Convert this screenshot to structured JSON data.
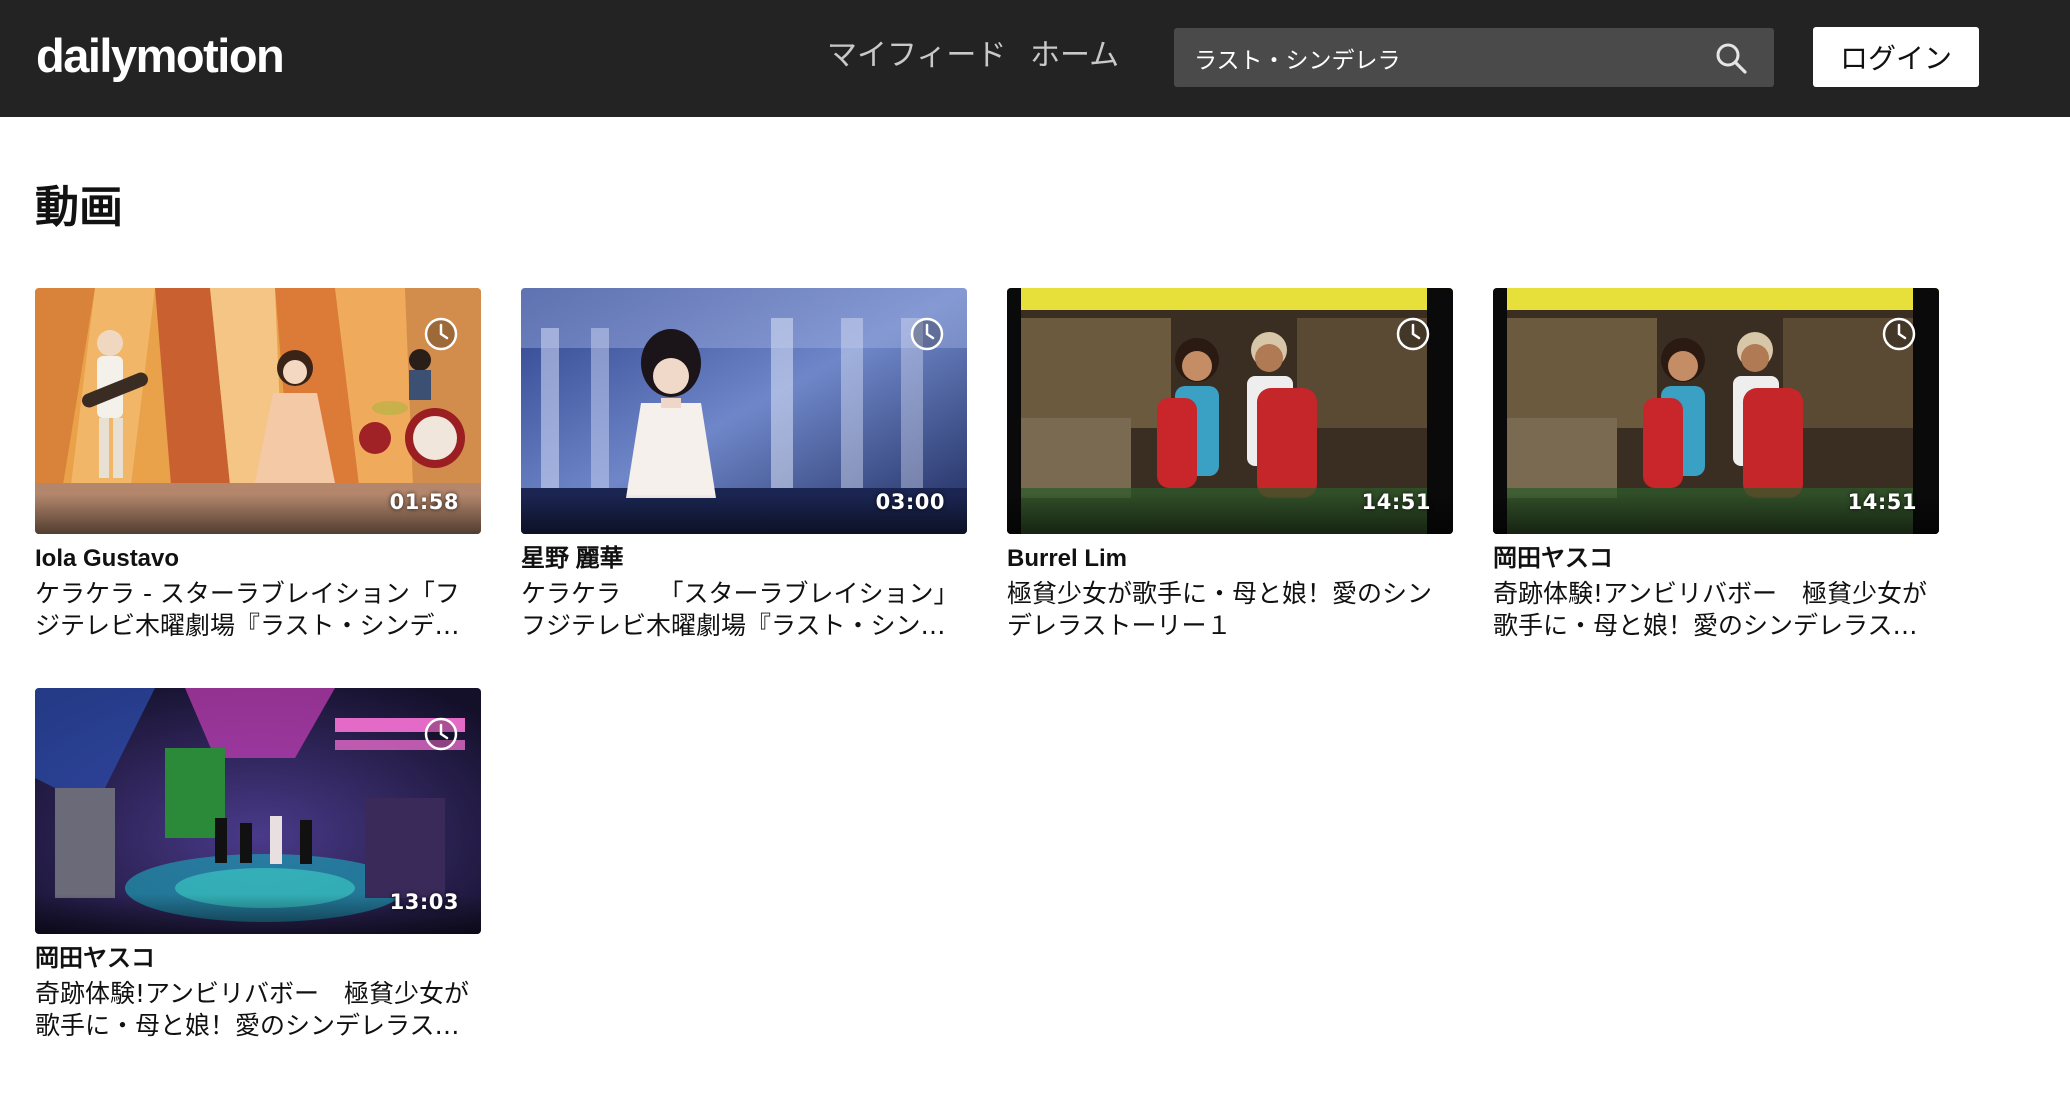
{
  "header": {
    "logo": "dailymotion",
    "nav": {
      "feed": "マイフィード",
      "home": "ホーム"
    },
    "search": {
      "value": "ラスト・シンデレラ",
      "icon": "search-icon"
    },
    "login_label": "ログイン"
  },
  "section": {
    "title": "動画"
  },
  "videos": [
    {
      "channel": "Iola Gustavo",
      "title": "ケラケラ - スターラブレイション「フジテレビ木曜劇場『ラスト・シンデレラ』",
      "duration": "01:58"
    },
    {
      "channel": "星野 麗華",
      "title": "ケラケラ　　「スターラブレイション」　フジテレビ木曜劇場『ラスト・シンデレラ』",
      "duration": "03:00"
    },
    {
      "channel": "Burrel Lim",
      "title": "極貧少女が歌手に・母と娘！愛のシンデレラストーリー１",
      "duration": "14:51"
    },
    {
      "channel": "岡田ヤスコ",
      "title": "奇跡体験!アンビリバボー　極貧少女が歌手に・母と娘！愛のシンデレラストーリー",
      "duration": "14:51"
    },
    {
      "channel": "岡田ヤスコ",
      "title": "奇跡体験!アンビリバボー　極貧少女が歌手に・母と娘！愛のシンデレラストーリー",
      "duration": "13:03"
    }
  ],
  "colors": {
    "header_bg": "#232323",
    "search_bg": "#4a4a4a",
    "nav_text": "#c9c9c9"
  }
}
